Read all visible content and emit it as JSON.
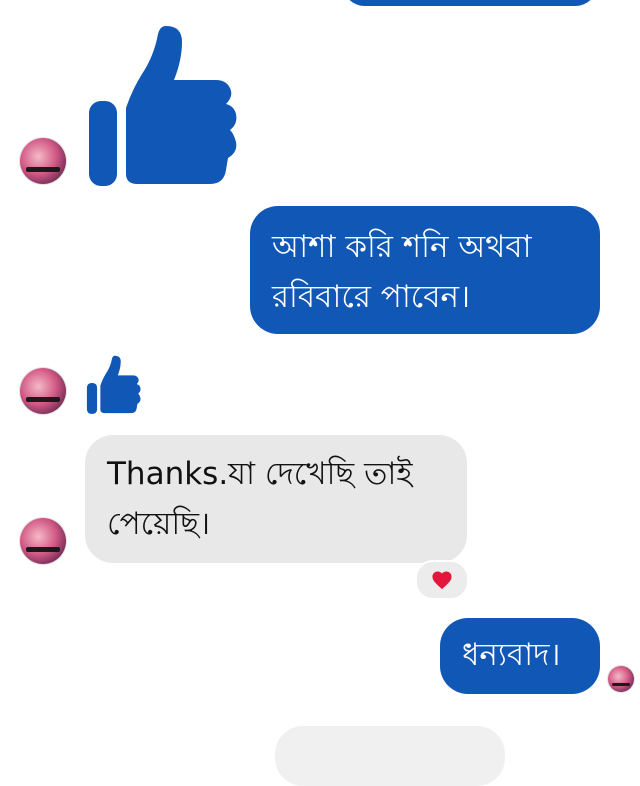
{
  "theme": {
    "outgoing_bubble_color": "#1157b5",
    "incoming_bubble_color": "#e8e8e8",
    "like_color": "#1157b5",
    "heart_color": "#e4163c"
  },
  "messages": [
    {
      "sender": "me",
      "type": "text",
      "lines": [
        "আশা করি শনি অথবা",
        "রবিবারে পাবেন।"
      ]
    },
    {
      "sender": "them",
      "type": "like",
      "icon": "thumbs-up-icon"
    },
    {
      "sender": "them",
      "type": "text",
      "lines": [
        "Thanks.যা দেখেছি তাই",
        "পেয়েছি।"
      ],
      "reaction": "heart-icon"
    },
    {
      "sender": "me",
      "type": "text",
      "lines": [
        "ধন্যবাদ।"
      ]
    }
  ]
}
